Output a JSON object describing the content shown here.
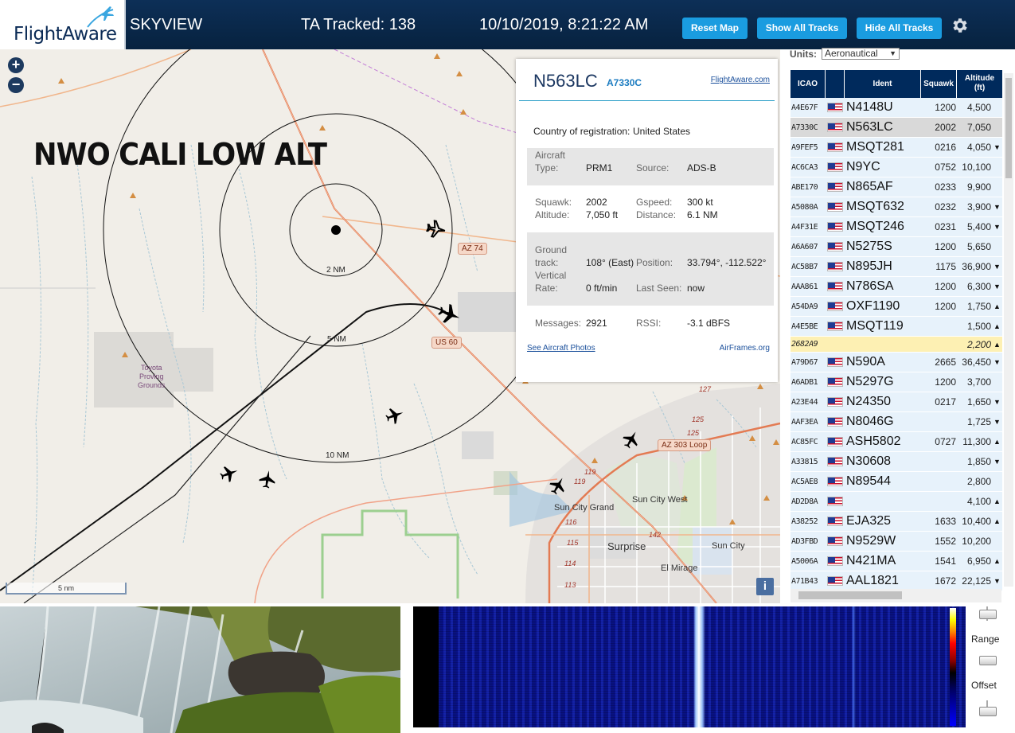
{
  "header": {
    "logo_text": "FlightAware",
    "app_name": "SKYVIEW",
    "tracked_label": "TA Tracked: 138",
    "datetime": "10/10/2019, 8:21:22 AM",
    "reset_map": "Reset Map",
    "show_all": "Show All Tracks",
    "hide_all": "Hide All Tracks",
    "settings_icon": "gear-icon"
  },
  "map": {
    "zoom_in": "+",
    "zoom_out": "−",
    "overlay_title": "NWO CALI LOW ALT",
    "rings": [
      "2 NM",
      "5 NM",
      "10 NM"
    ],
    "places": {
      "proving_grounds": "Toyota\nProving\nGrounds",
      "sun_city_grand": "Sun City Grand",
      "sun_city_west": "Sun City West",
      "surprise": "Surprise",
      "sun_city": "Sun City",
      "el_mirage": "El Mirage"
    },
    "routes": {
      "az74": "AZ 74",
      "us60": "US 60",
      "az303": "AZ 303 Loop"
    },
    "road_numbers": [
      "127",
      "125",
      "125",
      "119",
      "119",
      "116",
      "115",
      "114",
      "113",
      "142"
    ],
    "scale": "5 nm",
    "info_icon": "i"
  },
  "popup": {
    "ident": "N563LC",
    "hex": "A7330C",
    "fa_link": "FlightAware.com",
    "country_label": "Country of registration:",
    "country": "United States",
    "aircraft_type_label": "Aircraft Type:",
    "aircraft_type_label_1": "Aircraft",
    "aircraft_type_label_2": "Type:",
    "aircraft_type": "PRM1",
    "source_label": "Source:",
    "source": "ADS-B",
    "squawk_label": "Squawk:",
    "squawk": "2002",
    "gspeed_label": "Gspeed:",
    "gspeed": "300 kt",
    "altitude_label": "Altitude:",
    "altitude": "7,050 ft",
    "distance_label": "Distance:",
    "distance": "6.1 NM",
    "ground_label_1": "Ground",
    "ground_label_2": "track:",
    "ground_track": "108° (East)",
    "position_label": "Position:",
    "position": "33.794°, -112.522°",
    "vertical_label_1": "Vertical",
    "vertical_label_2": "Rate:",
    "vertical_rate": "0 ft/min",
    "last_seen_label": "Last Seen:",
    "last_seen": "now",
    "messages_label": "Messages:",
    "messages": "2921",
    "rssi_label": "RSSI:",
    "rssi": "-3.1 dBFS",
    "photos_link": "See Aircraft Photos",
    "airframes_link": "AirFrames.org"
  },
  "panel": {
    "units_label": "Units:",
    "units_value": "Aeronautical",
    "columns": {
      "icao": "ICAO",
      "ident": "Ident",
      "squawk": "Squawk",
      "altitude_1": "Altitude",
      "altitude_2": "(ft)"
    },
    "rows": [
      {
        "icao": "A4E67F",
        "ident": "N4148U",
        "squawk": "1200",
        "alt": "4,500",
        "dir": ""
      },
      {
        "icao": "A7330C",
        "ident": "N563LC",
        "squawk": "2002",
        "alt": "7,050",
        "dir": ""
      },
      {
        "icao": "A9FEF5",
        "ident": "MSQT281",
        "squawk": "0216",
        "alt": "4,050",
        "dir": "▼"
      },
      {
        "icao": "AC6CA3",
        "ident": "N9YC",
        "squawk": "0752",
        "alt": "10,100",
        "dir": ""
      },
      {
        "icao": "ABE170",
        "ident": "N865AF",
        "squawk": "0233",
        "alt": "9,900",
        "dir": ""
      },
      {
        "icao": "A5080A",
        "ident": "MSQT632",
        "squawk": "0232",
        "alt": "3,900",
        "dir": "▼"
      },
      {
        "icao": "A4F31E",
        "ident": "MSQT246",
        "squawk": "0231",
        "alt": "5,400",
        "dir": "▼"
      },
      {
        "icao": "A6A607",
        "ident": "N5275S",
        "squawk": "1200",
        "alt": "5,650",
        "dir": ""
      },
      {
        "icao": "AC58B7",
        "ident": "N895JH",
        "squawk": "1175",
        "alt": "36,900",
        "dir": "▼"
      },
      {
        "icao": "AAA861",
        "ident": "N786SA",
        "squawk": "1200",
        "alt": "6,300",
        "dir": "▼"
      },
      {
        "icao": "A54DA9",
        "ident": "OXF1190",
        "squawk": "1200",
        "alt": "1,750",
        "dir": "▲"
      },
      {
        "icao": "A4E5BE",
        "ident": "MSQT119",
        "squawk": "",
        "alt": "1,500",
        "dir": "▲"
      },
      {
        "icao": "2682A9",
        "ident": "",
        "squawk": "",
        "alt": "2,200",
        "dir": "▲"
      },
      {
        "icao": "A79D67",
        "ident": "N590A",
        "squawk": "2665",
        "alt": "36,450",
        "dir": "▼"
      },
      {
        "icao": "A6ADB1",
        "ident": "N5297G",
        "squawk": "1200",
        "alt": "3,700",
        "dir": ""
      },
      {
        "icao": "A23E44",
        "ident": "N24350",
        "squawk": "0217",
        "alt": "1,650",
        "dir": "▼"
      },
      {
        "icao": "AAF3EA",
        "ident": "N8046G",
        "squawk": "",
        "alt": "1,725",
        "dir": "▼"
      },
      {
        "icao": "AC85FC",
        "ident": "ASH5802",
        "squawk": "0727",
        "alt": "11,300",
        "dir": "▲"
      },
      {
        "icao": "A33815",
        "ident": "N30608",
        "squawk": "",
        "alt": "1,850",
        "dir": "▼"
      },
      {
        "icao": "AC5AE8",
        "ident": "N89544",
        "squawk": "",
        "alt": "2,800",
        "dir": ""
      },
      {
        "icao": "AD2D8A",
        "ident": "",
        "squawk": "",
        "alt": "4,100",
        "dir": "▲"
      },
      {
        "icao": "A38252",
        "ident": "EJA325",
        "squawk": "1633",
        "alt": "10,400",
        "dir": "▲"
      },
      {
        "icao": "AD3FBD",
        "ident": "N9529W",
        "squawk": "1552",
        "alt": "10,200",
        "dir": ""
      },
      {
        "icao": "A5006A",
        "ident": "N421MA",
        "squawk": "1541",
        "alt": "6,950",
        "dir": "▲"
      },
      {
        "icao": "A71B43",
        "ident": "AAL1821",
        "squawk": "1672",
        "alt": "22,125",
        "dir": "▼"
      }
    ]
  },
  "spectrogram": {
    "range_label": "Range",
    "offset_label": "Offset"
  },
  "colors": {
    "header_bg": "#0d2f57",
    "button": "#1a9ce0",
    "table_header": "#002a5c",
    "row_bg": "#e7f2fb",
    "selected_row": "#d9d9d9",
    "highlight_row": "#fdf0b3"
  }
}
